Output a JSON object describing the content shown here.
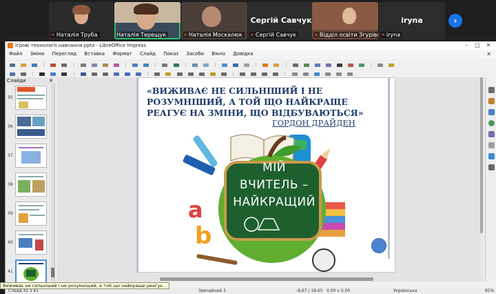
{
  "call": {
    "participants": [
      {
        "name": "Наталія Труба",
        "muted": true
      },
      {
        "name": "Наталія Терещук",
        "muted": false,
        "active": true
      },
      {
        "name": "Наталія Москалюк",
        "muted": true
      },
      {
        "name": "Сергій Савчук",
        "muted": true,
        "avatar_text": "Сергій Савчук"
      },
      {
        "name": "Відділ освіти Згурівської ...",
        "muted": true
      },
      {
        "name": "iryna",
        "muted": true,
        "avatar_text": "iryna"
      }
    ],
    "next_label": "›"
  },
  "window": {
    "title": "Ігрові технології навчання.pptx - LibreOffice Impress",
    "controls": [
      "–",
      "▢",
      "✕"
    ]
  },
  "menu": {
    "items": [
      "Файл",
      "Зміни",
      "Перегляд",
      "Вставка",
      "Формат",
      "Слайд",
      "Показ",
      "Засоби",
      "Вікно",
      "Довідка"
    ],
    "close": "✕"
  },
  "slides_pane": {
    "title": "Слайди",
    "close": "✕",
    "thumbnails": [
      {
        "number": "35"
      },
      {
        "number": "36"
      },
      {
        "number": "37"
      },
      {
        "number": "38"
      },
      {
        "number": "39"
      },
      {
        "number": "40"
      },
      {
        "number": "41",
        "selected": true
      }
    ]
  },
  "slide": {
    "quote": "«ВИЖИВАЄ НЕ СИЛЬНІШИЙ І НЕ РОЗУМНІШИЙ, А ТОЙ ЩО НАЙКРАЩЕ РЕАГУЄ НА ЗМІНИ, ЩО ВІДБУВАЮТЬСЯ»",
    "author": "ГОРДОН ДРАЙДЕН",
    "art_lines": [
      "МІЙ",
      "ВЧИТЕЛЬ –",
      "НАЙКРАЩИЙ"
    ]
  },
  "status": {
    "slide": "Слайд 41 з 41",
    "layout": "Звичайний 3",
    "position": "-8,67 / 18,65",
    "size": "0,00 x 0,00",
    "language": "Українська",
    "zoom": "85%"
  },
  "tooltip": "Виживає не сильніший і не розумніший, а той що найкраще реагує...",
  "colors": {
    "quote": "#1f3b6b",
    "active_tile": "#2fbf71",
    "board": "#1e5f2e",
    "apple": "#5fae2f",
    "accent_dot": "#4d84d0"
  }
}
